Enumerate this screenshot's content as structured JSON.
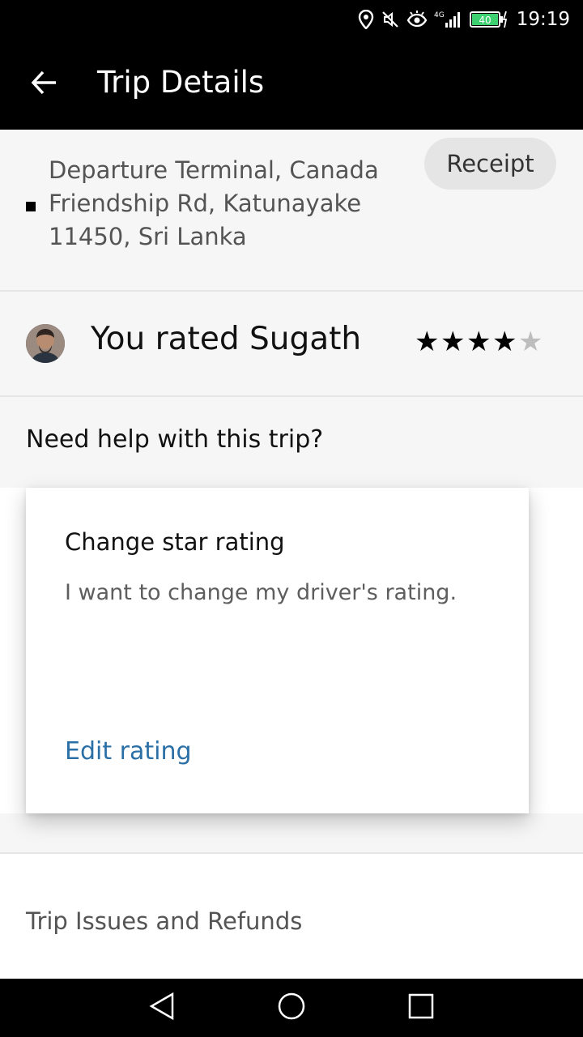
{
  "status_bar": {
    "time": "19:19",
    "battery": "40",
    "network": "4G"
  },
  "app_bar": {
    "title": "Trip Details"
  },
  "trip": {
    "dropoff_address": "Departure Terminal, Canada Friendship Rd, Katunayake 11450, Sri Lanka",
    "receipt_label": "Receipt"
  },
  "rating": {
    "text": "You rated Sugath",
    "stars_filled": 4,
    "stars_total": 5,
    "star_on_color": "#000000",
    "star_off_color": "#bdbdbd"
  },
  "help": {
    "question": "Need help with this trip?",
    "card_title": "Change star rating",
    "card_description": "I want to change my driver's rating.",
    "card_action": "Edit rating"
  },
  "issues": {
    "label": "Trip Issues and Refunds"
  },
  "colors": {
    "link": "#2a6fa5",
    "bar_background": "#000000",
    "page_background": "#f6f6f6"
  }
}
